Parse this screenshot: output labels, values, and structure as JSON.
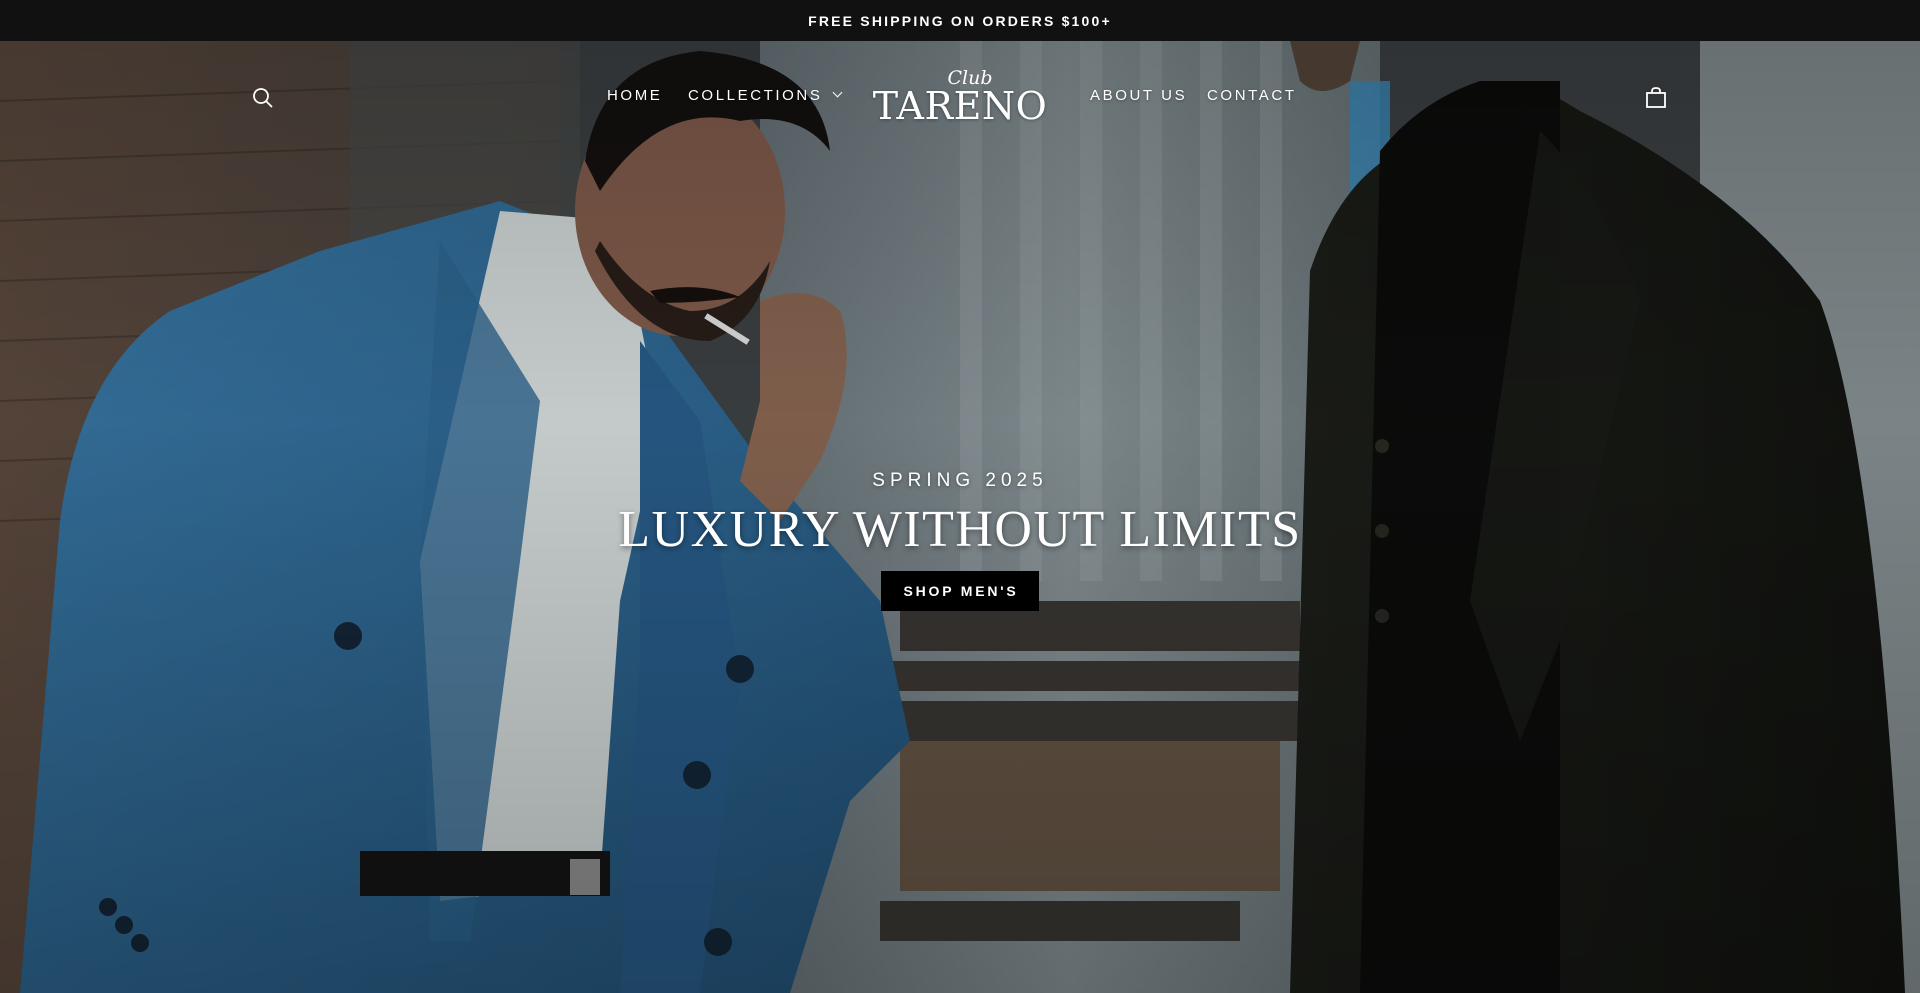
{
  "announcement": {
    "text": "FREE SHIPPING ON ORDERS $100+"
  },
  "header": {
    "search_icon": "search-icon",
    "cart_icon": "shopping-bag-icon",
    "logo": {
      "top": "Club",
      "main": "TARENO"
    },
    "nav": {
      "home": "HOME",
      "collections": "COLLECTIONS",
      "about": "ABOUT US",
      "contact": "CONTACT"
    }
  },
  "hero": {
    "eyebrow": "SPRING 2025",
    "headline": "LUXURY WITHOUT LIMITS",
    "cta_label": "SHOP MEN'S"
  },
  "colors": {
    "announcement_bg": "#111111",
    "button_bg": "#000000",
    "text": "#ffffff"
  }
}
